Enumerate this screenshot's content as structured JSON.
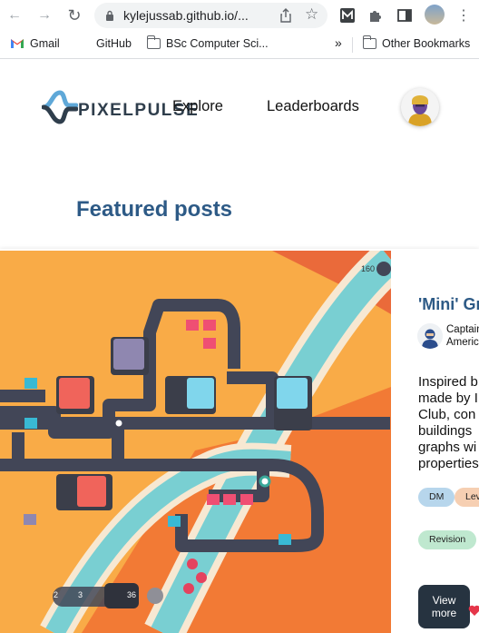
{
  "browser": {
    "url": "kylejussab.github.io/...",
    "bookmarks": [
      {
        "label": "Gmail",
        "icon": "gmail-icon"
      },
      {
        "label": "GitHub",
        "icon": "github-icon"
      },
      {
        "label": "BSc Computer Sci...",
        "icon": "folder-icon"
      }
    ],
    "overflow_label": "»",
    "other_bookmarks": "Other Bookmarks"
  },
  "site": {
    "brand": "PIXELPULSE",
    "nav": [
      "Explore",
      "Leaderboards"
    ]
  },
  "section_title": "Featured posts",
  "post": {
    "title": "'Mini' Gr",
    "author": [
      "Captain",
      "Americ"
    ],
    "description": [
      "Inspired b",
      "made by I",
      "Club, con",
      "buildings",
      "graphs wi",
      "properties"
    ],
    "tags": [
      "DM",
      "Lev",
      "Revision"
    ],
    "view_more": [
      "View",
      "more"
    ],
    "image": {
      "counter": "160",
      "badges": [
        "2",
        "3",
        "36"
      ]
    }
  },
  "colors": {
    "title_blue": "#2d5a86",
    "brand_dark": "#2f3e4c",
    "tag_blue": "#b7d6ec",
    "tag_peach": "#f6cfb2",
    "tag_green": "#bfe8cf",
    "button_dark": "#263340"
  }
}
